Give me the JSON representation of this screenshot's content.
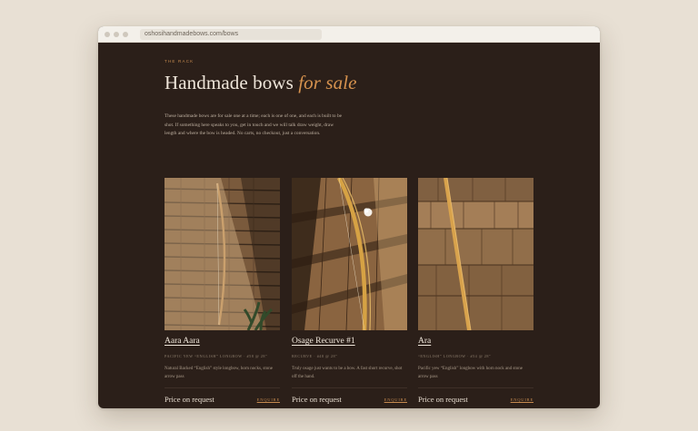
{
  "browser": {
    "url": "oshosihandmadebows.com/bows"
  },
  "page": {
    "eyebrow": "THE RACK",
    "headline_main": "Handmade bows ",
    "headline_accent": "for sale",
    "intro": "These handmade bows are for sale one at a time; each is one of one, and each is built to be shot. If something here speaks to you, get in touch and we will talk draw weight, draw length and where the bow is headed. No carts, no checkout, just a conversation."
  },
  "bows": [
    {
      "name": "Aara Aara",
      "meta": "PACIFIC YEW “ENGLISH” LONGBOW · #58 @ 28″",
      "description": "Natural Backed “English” style longbow, horn nocks, stone arrow pass",
      "price": "Price on request",
      "cta": "ENQUIRE"
    },
    {
      "name": "Osage Recurve #1",
      "meta": "RECURVE · #48 @ 28″",
      "description": "Truly osage just wants to be a bow. A fast short recurve, shot off the hand.",
      "price": "Price on request",
      "cta": "ENQUIRE"
    },
    {
      "name": "Ara",
      "meta": "“ENGLISH” LONGBOW · #54 @ 28″",
      "description": "Pacific yew “English” longbow with horn nock and stone arrow pass",
      "price": "Price on request",
      "cta": "ENQUIRE"
    }
  ],
  "colors": {
    "page_background": "#2b1f19",
    "accent": "#d6924e",
    "text": "#efe6da",
    "backdrop": "#e8e0d4"
  }
}
